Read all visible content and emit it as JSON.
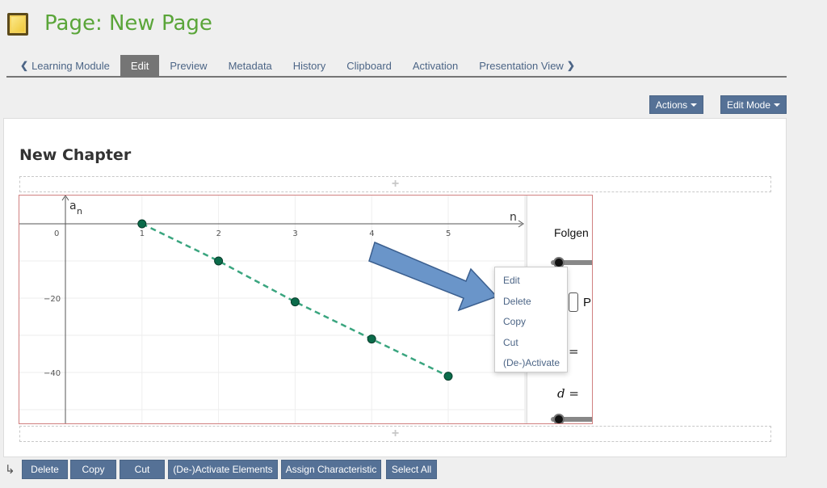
{
  "header": {
    "title": "Page: New Page"
  },
  "tabs": [
    {
      "label": "Learning Module",
      "back": true
    },
    {
      "label": "Edit",
      "active": true
    },
    {
      "label": "Preview"
    },
    {
      "label": "Metadata"
    },
    {
      "label": "History"
    },
    {
      "label": "Clipboard"
    },
    {
      "label": "Activation"
    },
    {
      "label": "Presentation View",
      "forward": true
    }
  ],
  "toolbar": {
    "actions_label": "Actions",
    "edit_mode_label": "Edit Mode"
  },
  "content": {
    "chapter_title": "New Chapter",
    "add_symbol": "+"
  },
  "graph": {
    "y_axis_label": "a",
    "y_axis_subscript": "n",
    "x_axis_label": "n",
    "origin_label": "0",
    "x_ticks": [
      "1",
      "2",
      "3",
      "4",
      "5"
    ],
    "y_ticks": [
      "−20",
      "−40"
    ],
    "points": [
      {
        "n": 1,
        "a": 0
      },
      {
        "n": 2,
        "a": -10
      },
      {
        "n": 3,
        "a": -21
      },
      {
        "n": 4,
        "a": -31
      },
      {
        "n": 5,
        "a": -41
      }
    ],
    "point_color": "#0b6b4a",
    "line_color": "#3aa57f"
  },
  "algebra": {
    "folgen_label": "Folgen",
    "p_label": "P",
    "eq_label": "=",
    "d_label": "d ="
  },
  "context_menu": {
    "items": [
      "Edit",
      "Delete",
      "Copy",
      "Cut",
      "(De-)Activate"
    ]
  },
  "bottom_bar": {
    "arrow": "↳",
    "buttons": [
      "Delete",
      "Copy",
      "Cut",
      "(De-)Activate Elements",
      "Assign Characteristic",
      "Select All"
    ]
  },
  "colors": {
    "accent": "#557196",
    "title_green": "#5aa539",
    "arrow_blue": "#6a95c9"
  }
}
